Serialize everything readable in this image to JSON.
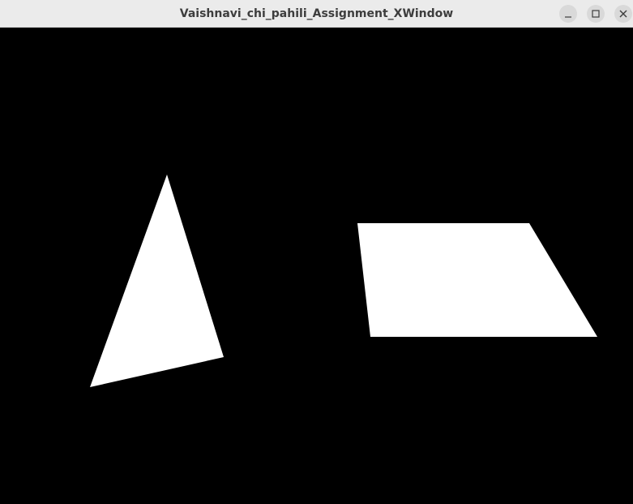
{
  "window": {
    "title": "Vaishnavi_chi_pahili_Assignment_XWindow",
    "buttons": [
      "minimize",
      "maximize",
      "close"
    ]
  },
  "canvas": {
    "background_color": "#000000",
    "shapes": [
      {
        "type": "triangle",
        "fill": "#ffffff"
      },
      {
        "type": "quadrilateral",
        "fill": "#ffffff"
      }
    ]
  }
}
